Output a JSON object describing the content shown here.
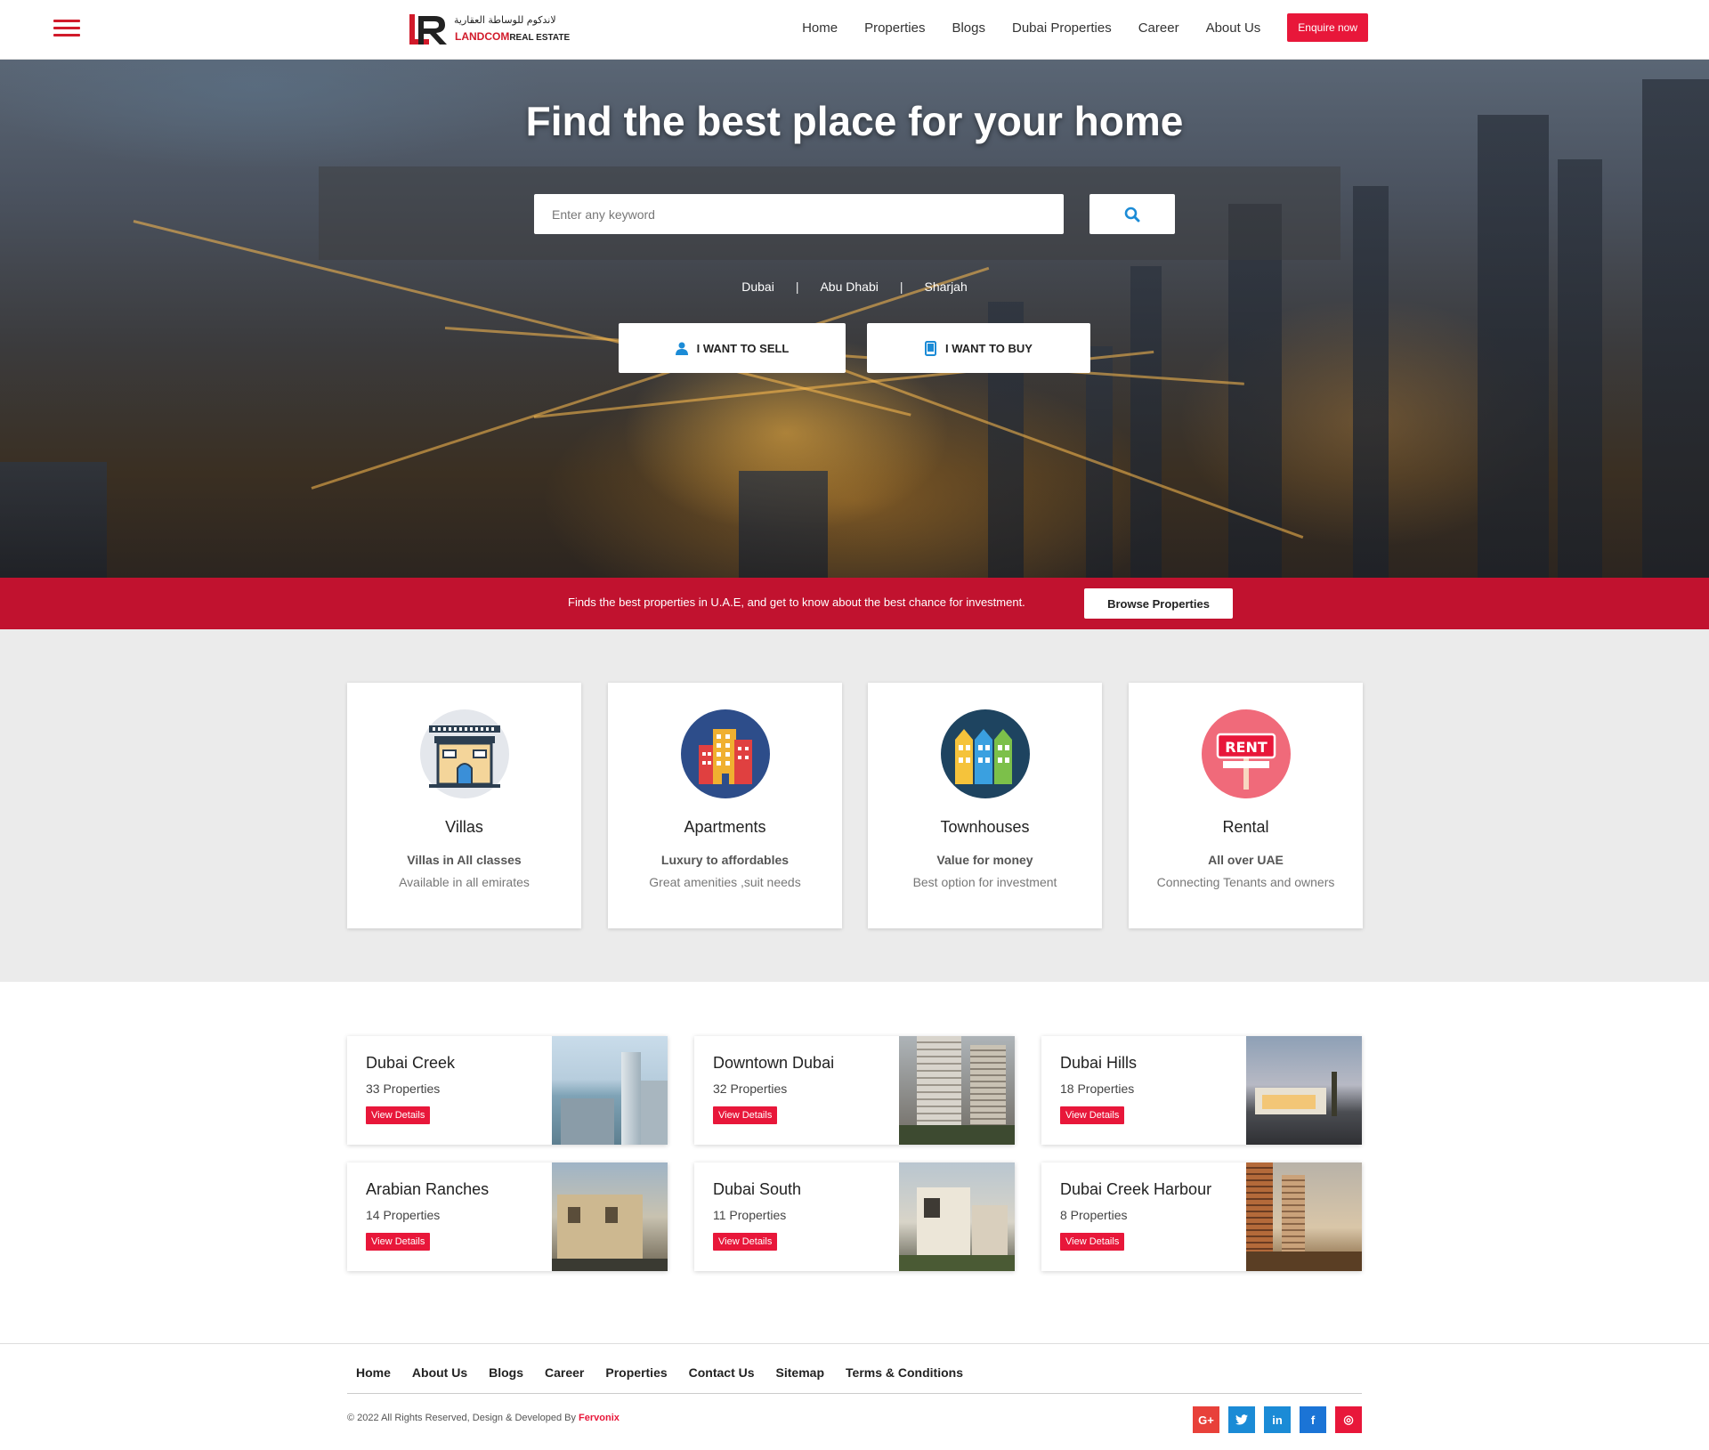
{
  "header": {
    "logo_arabic": "لاندكوم للوساطة العقارية",
    "logo_name": "LANDCOM",
    "logo_suffix": "REAL ESTATE",
    "nav": [
      "Home",
      "Properties",
      "Blogs",
      "Dubai Properties",
      "Career",
      "About Us"
    ],
    "enquire": "Enquire now"
  },
  "hero": {
    "title": "Find the best place for your home",
    "search_placeholder": "Enter any keyword",
    "cities": [
      "Dubai",
      "Abu Dhabi",
      "Sharjah"
    ],
    "separator": "|",
    "sell_label": "I WANT TO SELL",
    "buy_label": "I WANT TO BUY"
  },
  "band": {
    "text": "Finds the best properties in U.A.E, and get to know about the best chance for investment.",
    "button": "Browse Properties"
  },
  "categories": [
    {
      "title": "Villas",
      "line1": "Villas in All classes",
      "line2": "Available in all emirates",
      "icon": "villa-icon"
    },
    {
      "title": "Apartments",
      "line1": "Luxury to affordables",
      "line2": "Great amenities ,suit needs",
      "icon": "apartment-icon"
    },
    {
      "title": "Townhouses",
      "line1": "Value for money",
      "line2": "Best option for investment",
      "icon": "townhouse-icon"
    },
    {
      "title": "Rental",
      "line1": "All over UAE",
      "line2": "Connecting Tenants and owners",
      "icon": "rent-sign-icon",
      "icon_text": "RENT"
    }
  ],
  "locations": [
    {
      "name": "Dubai Creek",
      "count": "33 Properties",
      "button": "View Details"
    },
    {
      "name": "Downtown Dubai",
      "count": "32 Properties",
      "button": "View Details"
    },
    {
      "name": "Dubai Hills",
      "count": "18 Properties",
      "button": "View Details"
    },
    {
      "name": "Arabian Ranches",
      "count": "14 Properties",
      "button": "View Details"
    },
    {
      "name": "Dubai South",
      "count": "11 Properties",
      "button": "View Details"
    },
    {
      "name": "Dubai Creek Harbour",
      "count": "8 Properties",
      "button": "View Details"
    }
  ],
  "footer": {
    "links": [
      "Home",
      "About Us",
      "Blogs",
      "Career",
      "Properties",
      "Contact Us",
      "Sitemap",
      "Terms & Conditions"
    ],
    "copyright": "© 2022 All Rights Reserved, Design & Developed By",
    "developer": "Fervonix",
    "social": [
      {
        "name": "google-plus",
        "glyph": "G+",
        "color": "#e8413a"
      },
      {
        "name": "twitter",
        "glyph": "t",
        "color": "#1b8bd6"
      },
      {
        "name": "linkedin",
        "glyph": "in",
        "color": "#1b8bd6"
      },
      {
        "name": "facebook",
        "glyph": "f",
        "color": "#1b74d6"
      },
      {
        "name": "instagram",
        "glyph": "◎",
        "color": "#e8173a"
      }
    ]
  },
  "colors": {
    "accent": "#e8173a",
    "band": "#c1122f",
    "link_blue": "#1b8bd6"
  }
}
